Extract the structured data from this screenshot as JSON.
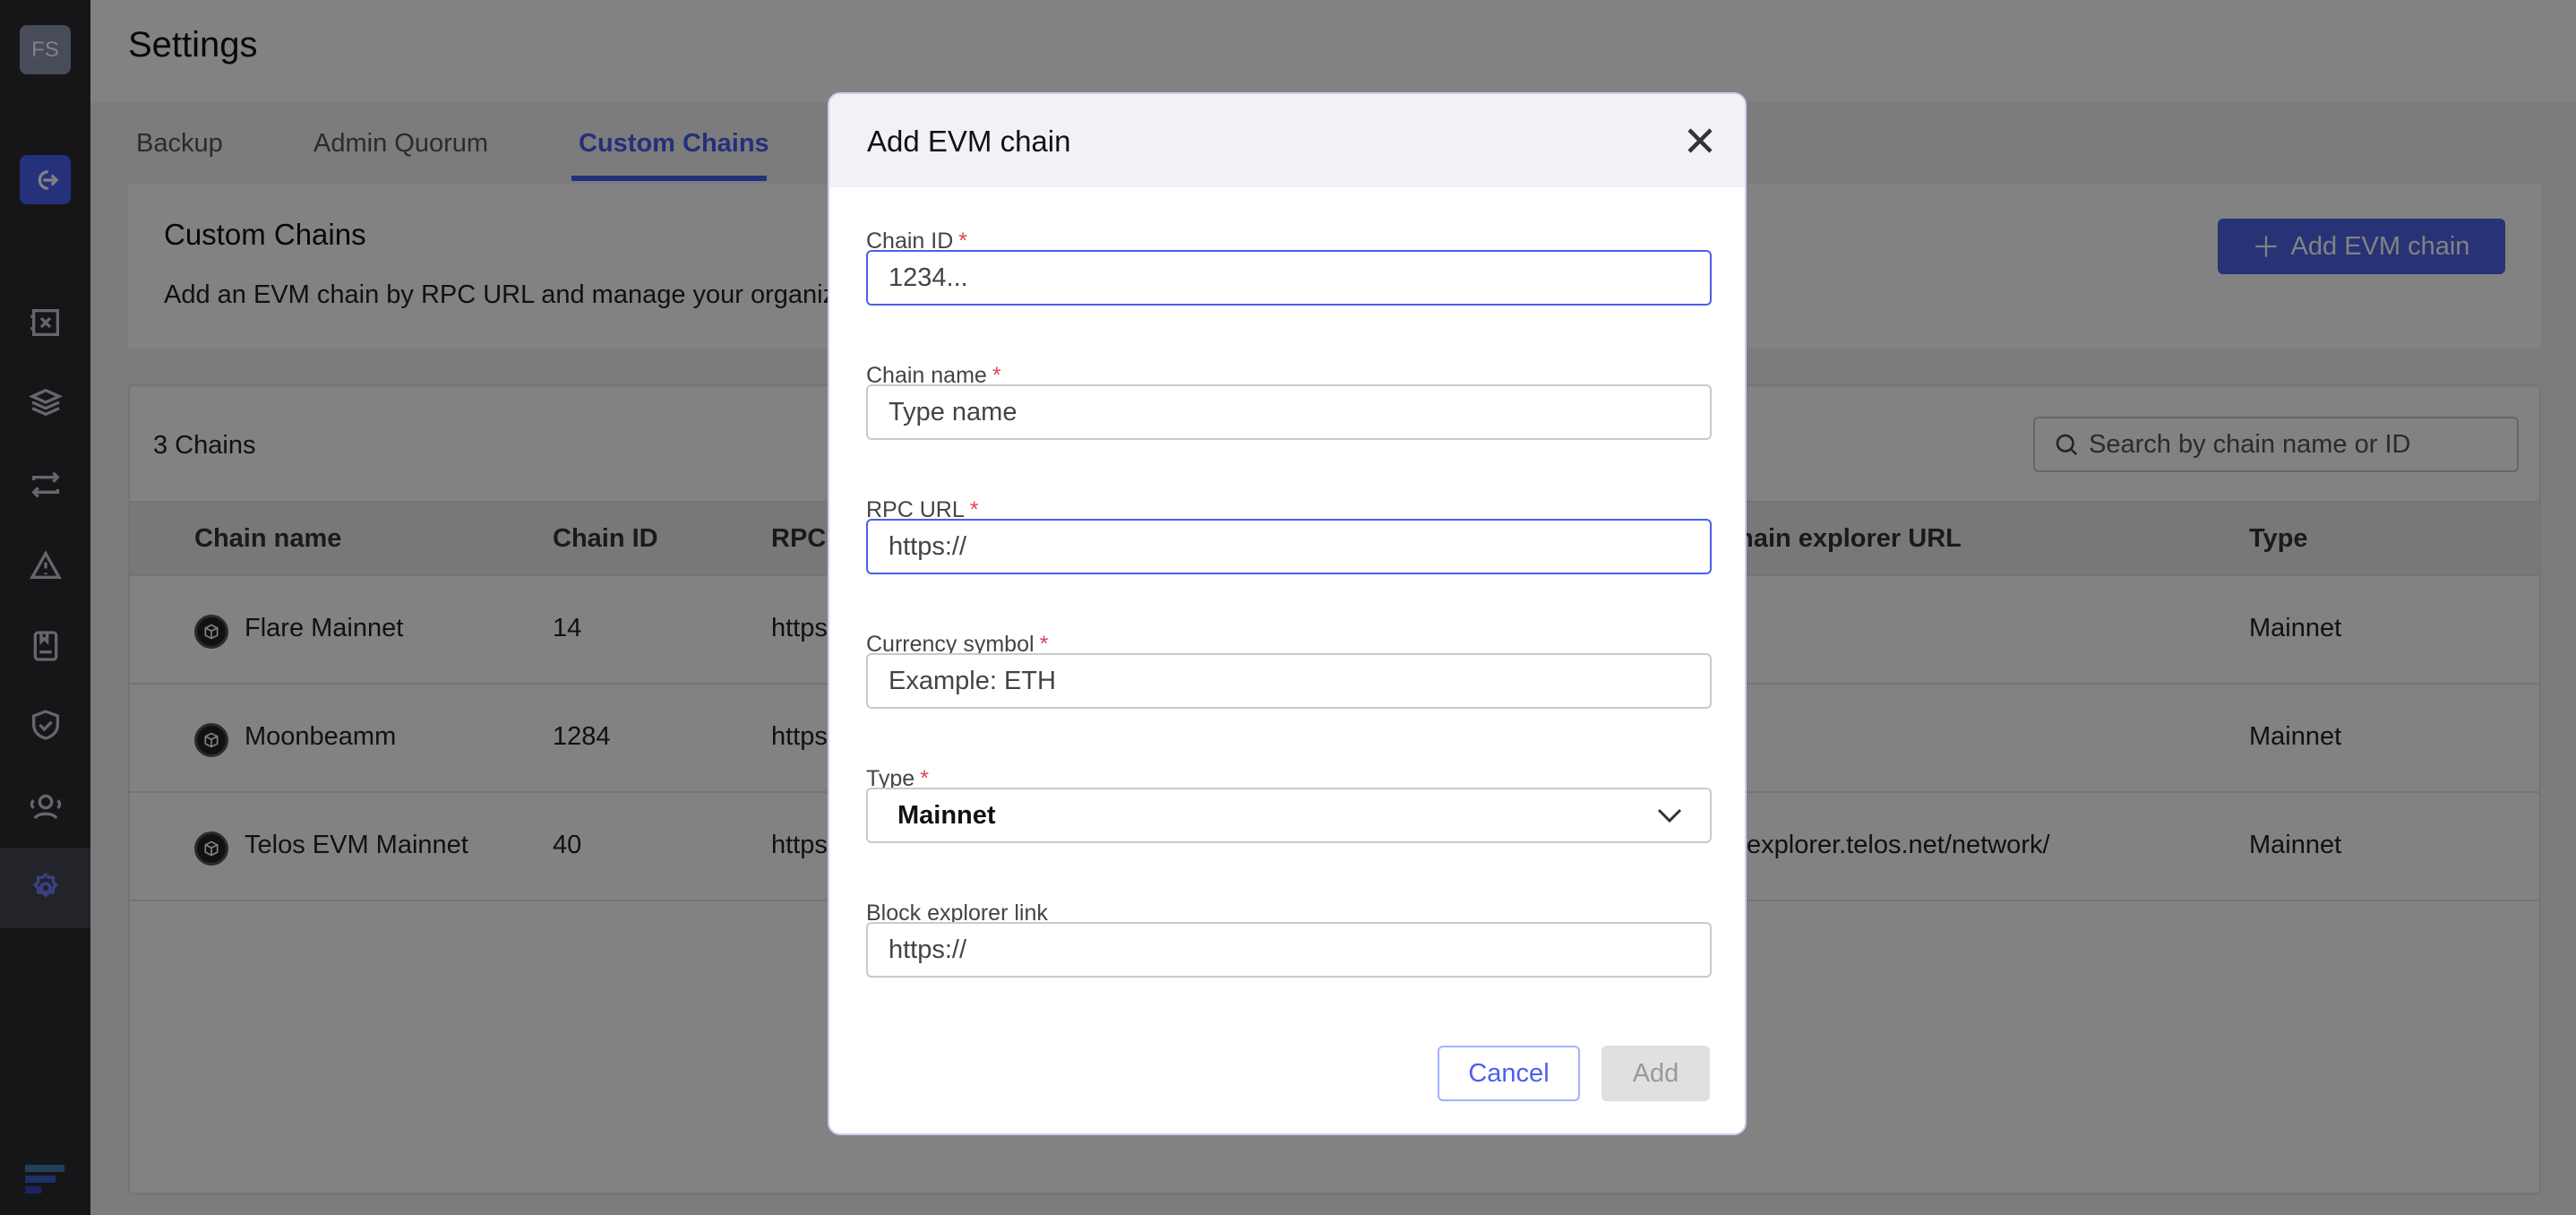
{
  "sidebar": {
    "avatar": "FS",
    "items": [
      "logout",
      "vault",
      "layers",
      "transfers",
      "alerts",
      "address-book",
      "policies",
      "users",
      "settings"
    ],
    "selected": "settings"
  },
  "header": {
    "title": "Settings"
  },
  "tabs": [
    {
      "label": "Backup"
    },
    {
      "label": "Admin Quorum"
    },
    {
      "label": "Custom Chains",
      "active": true
    }
  ],
  "section": {
    "title": "Custom Chains",
    "description": "Add an EVM chain by RPC URL and manage your organiz",
    "add_button": "Add EVM chain"
  },
  "table": {
    "count": "3 Chains",
    "search_placeholder": "Search by chain name or ID",
    "columns": [
      "Chain name",
      "Chain ID",
      "RPC",
      "Blockchain explorer URL",
      "Type"
    ],
    "rows": [
      {
        "name": "Flare Mainnet",
        "id": "14",
        "rpc": "https",
        "explorer": "",
        "type": "Mainnet"
      },
      {
        "name": "Moonbeamm",
        "id": "1284",
        "rpc": "https",
        "explorer": "",
        "type": "Mainnet"
      },
      {
        "name": "Telos EVM Mainnet",
        "id": "40",
        "rpc": "https",
        "explorer": "explorer.telos.net/network/",
        "type": "Mainnet"
      }
    ]
  },
  "modal": {
    "title": "Add EVM chain",
    "fields": [
      {
        "label": "Chain ID",
        "required": "*",
        "placeholder": "1234..."
      },
      {
        "label": "Chain name",
        "required": "*",
        "placeholder": "Type name"
      },
      {
        "label": "RPC URL",
        "required": "*",
        "placeholder": "https://"
      },
      {
        "label": "Currency symbol",
        "required": "*",
        "placeholder": "Example: ETH"
      },
      {
        "label": "Type",
        "required": "*",
        "value": "Mainnet"
      },
      {
        "label": "Block explorer link",
        "placeholder": "https://"
      }
    ],
    "cancel": "Cancel",
    "add": "Add"
  },
  "colors": {
    "accent": "#4a5ff0",
    "required": "#e0435a"
  }
}
